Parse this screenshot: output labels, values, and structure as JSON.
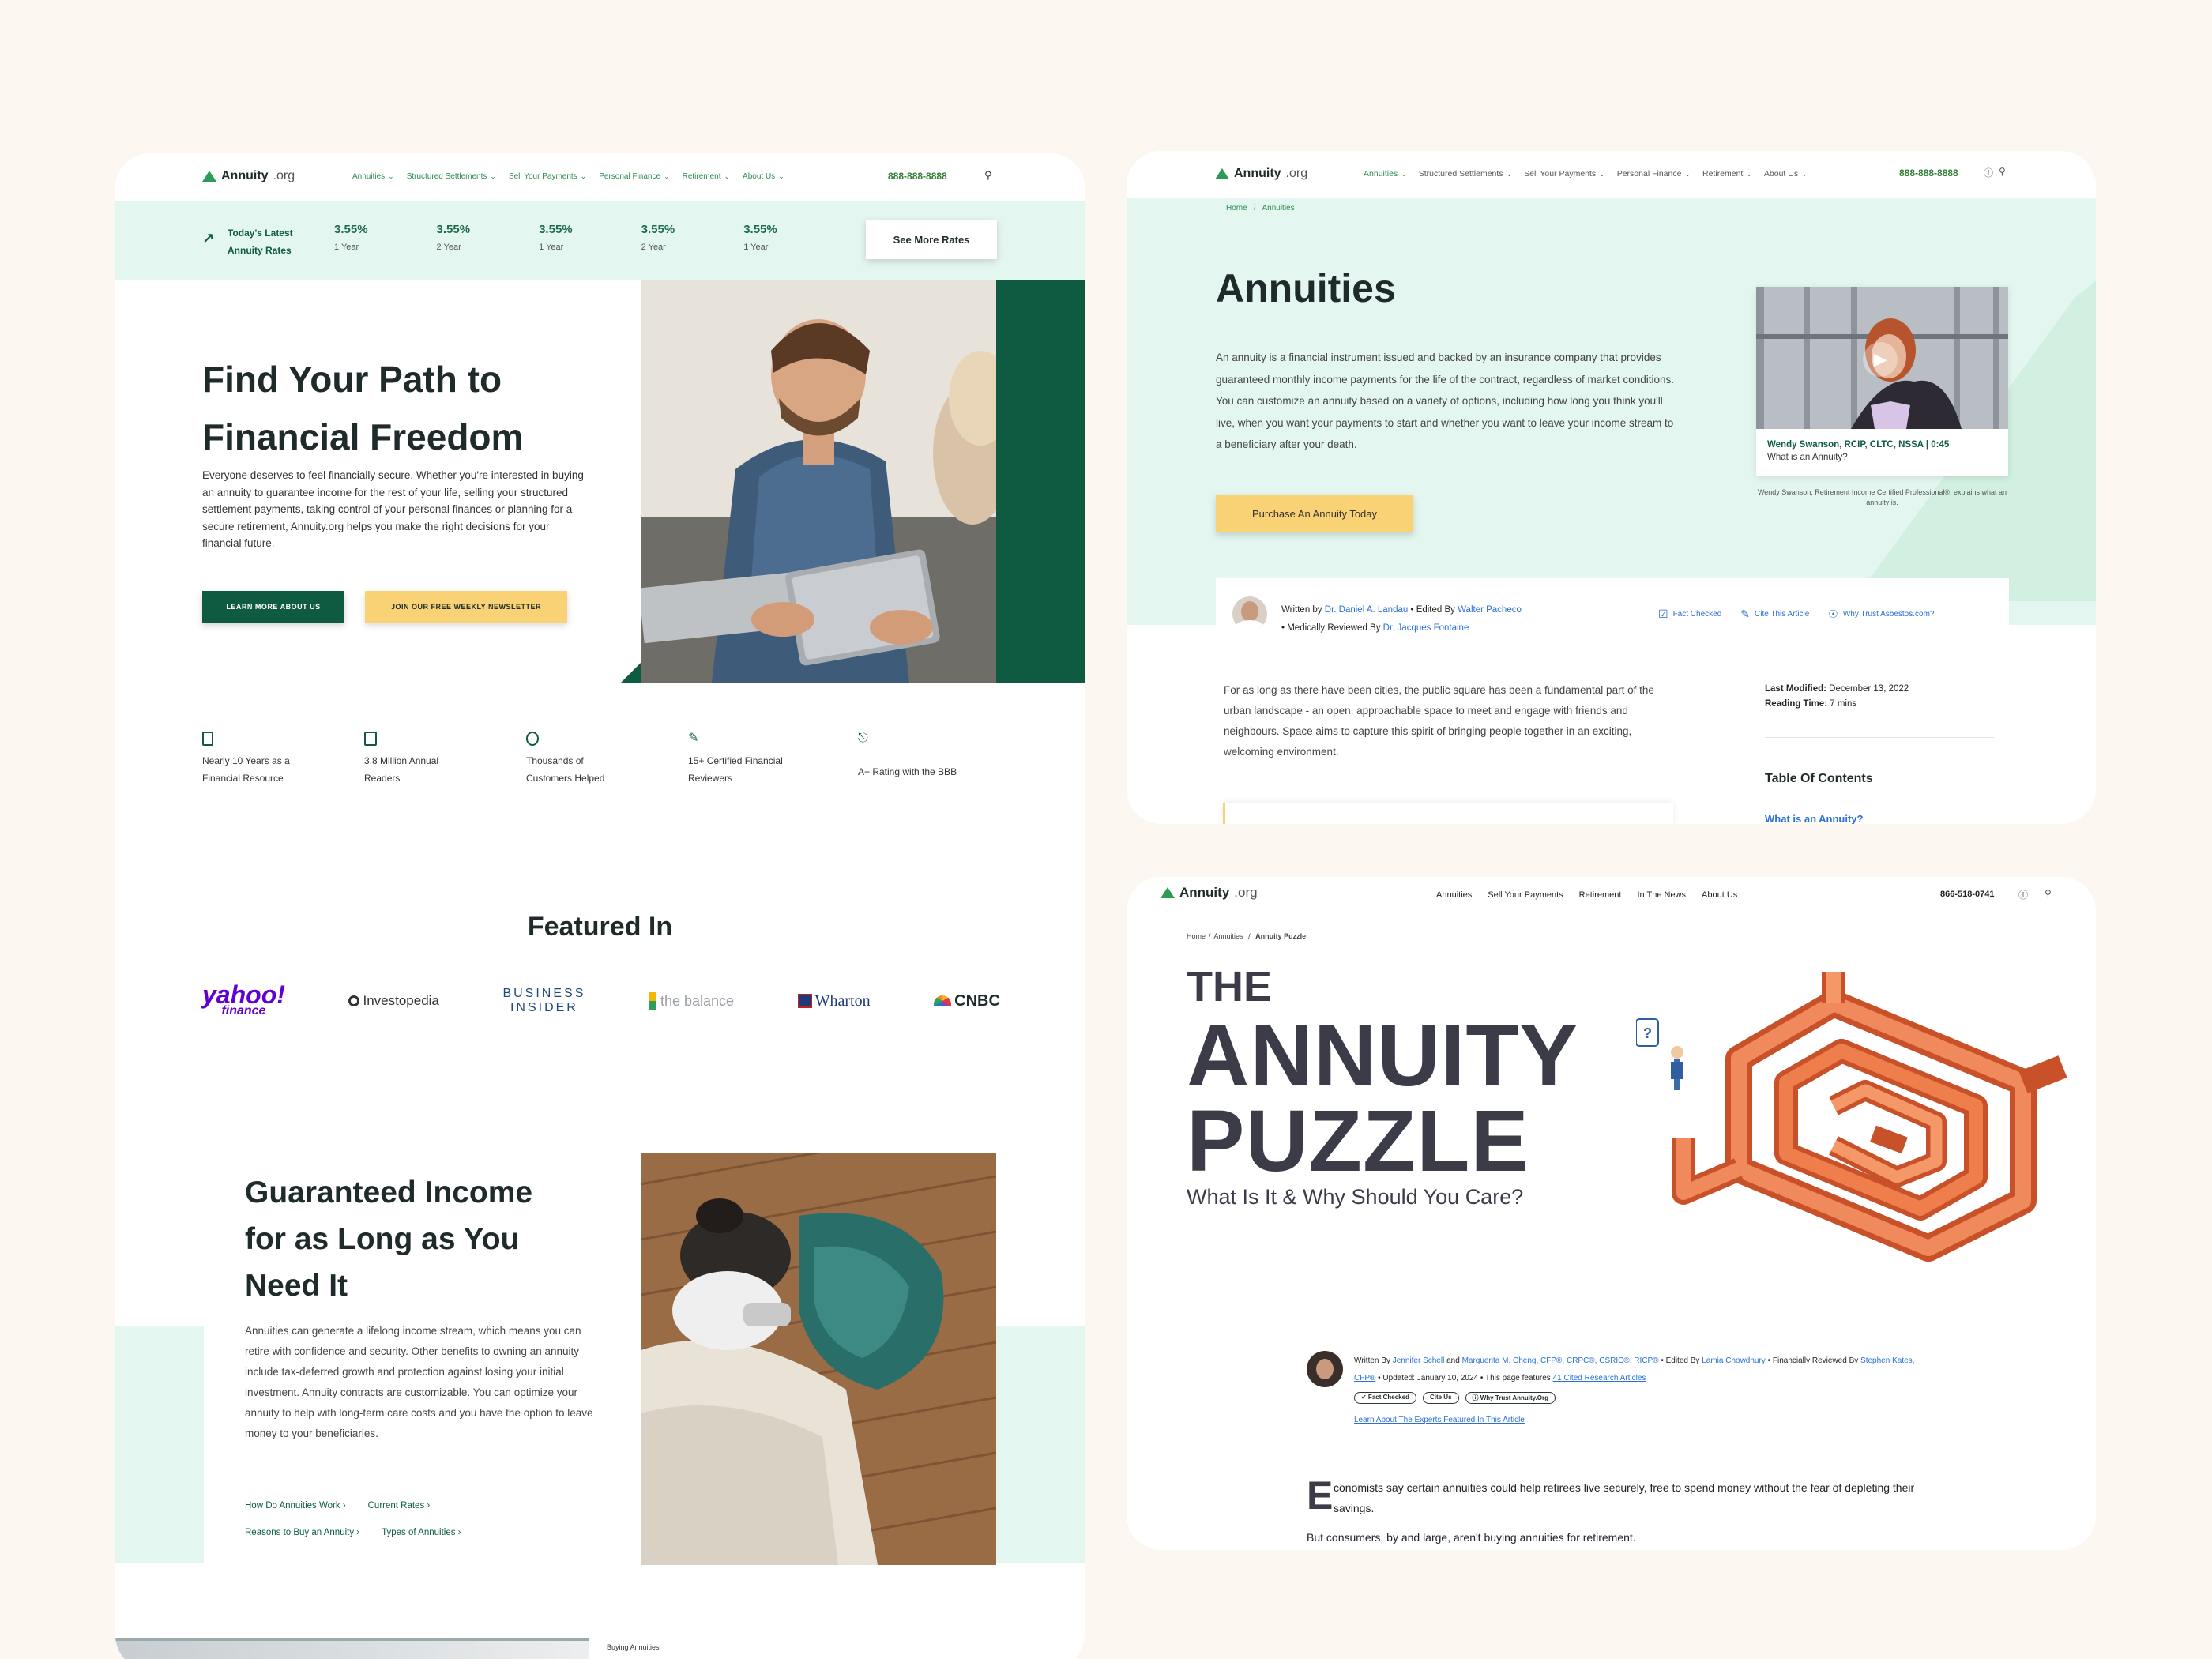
{
  "p1": {
    "logo": {
      "name": "Annuity",
      "suffix": ".org"
    },
    "nav": [
      "Annuities",
      "Structured Settlements",
      "Sell Your Payments",
      "Personal Finance",
      "Retirement",
      "About Us"
    ],
    "phone": "888-888-8888",
    "rates": {
      "label_line1": "Today's Latest",
      "label_line2": "Annuity Rates",
      "items": [
        {
          "rate": "3.55%",
          "term": "1 Year"
        },
        {
          "rate": "3.55%",
          "term": "2 Year"
        },
        {
          "rate": "3.55%",
          "term": "1 Year"
        },
        {
          "rate": "3.55%",
          "term": "2 Year"
        },
        {
          "rate": "3.55%",
          "term": "1 Year"
        }
      ],
      "button": "See More Rates"
    },
    "hero": {
      "title_line1": "Find Your Path to",
      "title_line2": "Financial Freedom",
      "body": "Everyone deserves to feel financially secure. Whether you're interested in buying an annuity to guarantee income for the rest of your life, selling your structured settlement payments, taking control of your personal finances or planning for a secure retirement, Annuity.org helps you make the right decisions for your financial future.",
      "btn_primary": "LEARN MORE ABOUT US",
      "btn_secondary": "JOIN OUR FREE WEEKLY NEWSLETTER"
    },
    "stats": [
      {
        "icon": "document-icon",
        "line1": "Nearly 10 Years as a",
        "line2": "Financial Resource"
      },
      {
        "icon": "reader-icon",
        "line1": "3.8 Million Annual",
        "line2": "Readers"
      },
      {
        "icon": "customers-icon",
        "line1": "Thousands of",
        "line2": "Customers Helped"
      },
      {
        "icon": "pen-icon",
        "line1": "15+ Certified Financial",
        "line2": "Reviewers"
      },
      {
        "icon": "bbb-icon",
        "line1": "A+ Rating with the BBB",
        "line2": ""
      }
    ],
    "featured": {
      "title": "Featured In",
      "logos": {
        "yahoo": "yahoo!",
        "yahoo_sub": "finance",
        "investopedia": "Investopedia",
        "bi_line1": "BUSINESS",
        "bi_line2": "INSIDER",
        "balance": "the balance",
        "wharton": "Wharton",
        "cnbc": "CNBC"
      }
    },
    "income": {
      "title_line1": "Guaranteed Income",
      "title_line2": "for as Long as You",
      "title_line3": "Need It",
      "body": "Annuities can generate a lifelong income stream, which means you can retire with confidence and security. Other benefits to owning an annuity include tax-deferred growth and protection against losing your initial investment. Annuity contracts are customizable. You can optimize your annuity to help with long-term care costs and you have the option to leave money to your beneficiaries.",
      "links": [
        "How Do Annuities Work",
        "Current Rates",
        "Reasons to Buy an Annuity",
        "Types of Annuities"
      ]
    },
    "bottom_label": "Buying Annuities"
  },
  "p2": {
    "logo": {
      "name": "Annuity",
      "suffix": ".org"
    },
    "nav": [
      "Annuities",
      "Structured Settlements",
      "Sell Your Payments",
      "Personal Finance",
      "Retirement",
      "About Us"
    ],
    "phone": "888-888-8888",
    "breadcrumb": [
      "Home",
      "Annuities"
    ],
    "title": "Annuities",
    "intro": "An annuity is a financial instrument issued and backed by an insurance company that provides guaranteed monthly income payments for the life of the contract, regardless of market conditions. You can customize an annuity based on a variety of options, including how long you think you'll live, when you want your payments to start and whether you want to leave your income stream to a beneficiary after your death.",
    "cta": "Purchase An Annuity Today",
    "video": {
      "speaker": "Wendy Swanson, RCIP, CLTC, NSSA | 0:45",
      "topic": "What is an Annuity?",
      "caption": "Wendy Swanson, Retirement Income Certified Professional®, explains what an annuity is."
    },
    "byline": {
      "written_by": "Written by",
      "author": "Dr. Daniel A. Landau",
      "edited_by": "• Edited By",
      "editor": "Walter Pacheco",
      "reviewed_by": "• Medically Reviewed By",
      "reviewer": "Dr. Jacques Fontaine",
      "actions": [
        "Fact Checked",
        "Cite This Article",
        "Why Trust Asbestos.com?"
      ]
    },
    "body": "For as long as there have been cities, the public square has been a fundamental part of the urban landscape - an open, approachable space to meet and engage with friends and neighbours. Space aims to capture this spirit of bringing people together in an exciting, welcoming environment.",
    "meta": {
      "modified_label": "Last Modified:",
      "modified": "December 13, 2022",
      "reading_label": "Reading Time:",
      "reading": "7 mins"
    },
    "toc": {
      "title": "Table Of Contents",
      "first": "What is an Annuity?"
    }
  },
  "p3": {
    "logo": {
      "name": "Annuity",
      "suffix": ".org"
    },
    "nav": [
      "Annuities",
      "Sell Your Payments",
      "Retirement",
      "In The News",
      "About Us"
    ],
    "phone": "866-518-0741",
    "breadcrumb": [
      "Home",
      "Annuities",
      "Annuity Puzzle"
    ],
    "title_small": "THE",
    "title_line1": "ANNUITY",
    "title_line2": "PUZZLE",
    "subtitle": "What Is It & Why Should You Care?",
    "byline": {
      "written_by": "Written By",
      "author1": "Jennifer Schell",
      "and": "and",
      "author2": "Marguerita M. Cheng, CFP®, CRPC®, CSRIC®, RICP®",
      "edited_by": "• Edited By",
      "editor": "Lamia Chowdhury",
      "fin_rev": "• Financially Reviewed By",
      "reviewer": "Stephen Kates, CFP®",
      "updated": "• Updated: January 10, 2024 • This page features",
      "cited": "41 Cited Research Articles",
      "badges": [
        "✔ Fact Checked",
        "Cite Us",
        "ⓘ Why Trust Annuity.Org"
      ],
      "experts": "Learn About The Experts Featured In This Article"
    },
    "dropcap": "E",
    "para1": "conomists say certain annuities could help retirees live securely, free to spend money without the fear of depleting their savings.",
    "para2": "But consumers, by and large, aren't buying annuities for retirement."
  },
  "colors": {
    "brand_green": "#0f5b42",
    "nav_green": "#2d8a52",
    "mint": "#e3f6ef",
    "yellow": "#f8d275",
    "maze_orange": "#e0693b",
    "link_blue": "#2a6fd6"
  }
}
